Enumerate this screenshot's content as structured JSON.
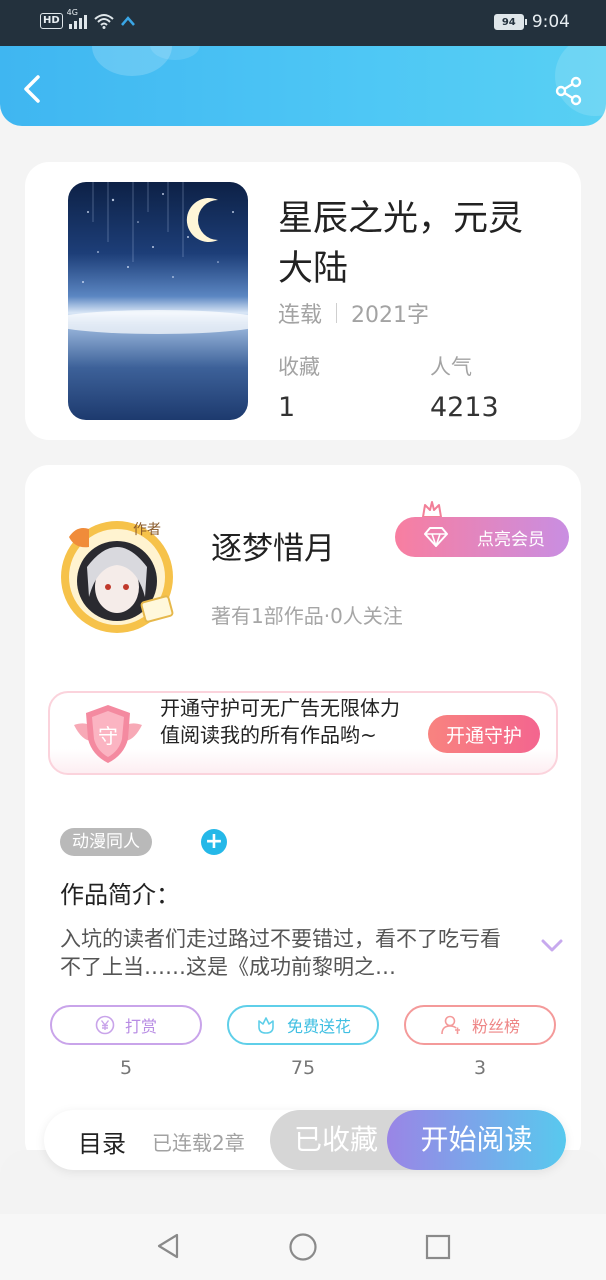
{
  "status_bar": {
    "network": "HD",
    "signal": "4G",
    "battery": "94",
    "time": "9:04"
  },
  "book": {
    "title": "星辰之光，元灵大陆",
    "status": "连载",
    "word_count": "2021字",
    "favorites_label": "收藏",
    "favorites_value": "1",
    "popularity_label": "人气",
    "popularity_value": "4213"
  },
  "author": {
    "avatar_badge": "作者",
    "name": "逐梦惜月",
    "vip_button": "点亮会员",
    "summary": "著有1部作品·0人关注"
  },
  "guard": {
    "badge": "守",
    "text": "开通守护可无广告无限体力值阅读我的所有作品哟~",
    "button": "开通守护"
  },
  "tags": {
    "tag": "动漫同人",
    "add": "+"
  },
  "intro": {
    "title": "作品简介：",
    "text": "入坑的读者们走过路过不要错过，看不了吃亏看不了上当……这是《成功前黎明之…"
  },
  "actions": [
    {
      "label": "打赏",
      "count": "5",
      "color": "#c9a4ea"
    },
    {
      "label": "免费送花",
      "count": "75",
      "color": "#5fcfe9"
    },
    {
      "label": "粉丝榜",
      "count": "3",
      "color": "#f49a9a"
    }
  ],
  "bottom_bar": {
    "toc": "目录",
    "toc_sub": "已连载2章",
    "collected": "已收藏",
    "read": "开始阅读"
  },
  "icons": [
    "back-icon",
    "share-icon",
    "diamond-icon",
    "crown-icon",
    "yen-icon",
    "flower-icon",
    "person-icon",
    "chevron-down-icon",
    "nav-back-icon",
    "nav-home-icon",
    "nav-recent-icon"
  ]
}
